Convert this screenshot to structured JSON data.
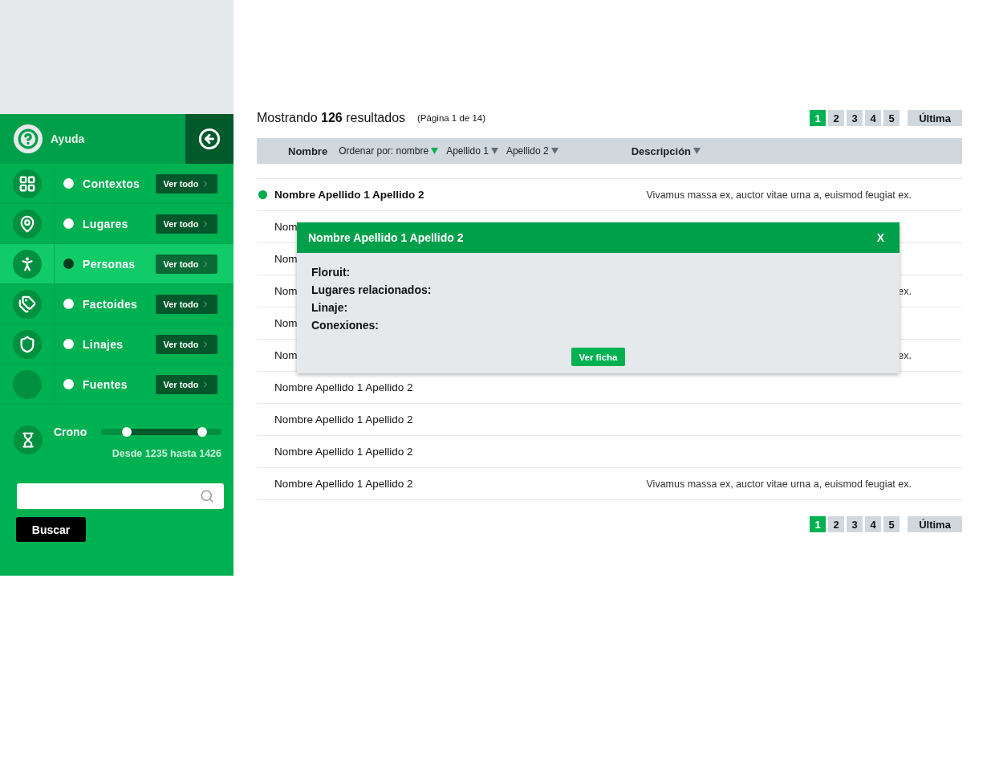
{
  "sidebar": {
    "help": {
      "label": "Ayuda"
    },
    "items": [
      {
        "label": "Contextos",
        "selected": false,
        "button": "Ver todo"
      },
      {
        "label": "Lugares",
        "selected": false,
        "button": "Ver todo"
      },
      {
        "label": "Personas",
        "selected": true,
        "button": "Ver todo"
      },
      {
        "label": "Factoides",
        "selected": false,
        "button": "Ver todo"
      },
      {
        "label": "Linajes",
        "selected": false,
        "button": "Ver todo"
      },
      {
        "label": "Fuentes",
        "selected": false,
        "button": "Ver todo"
      }
    ],
    "crono": {
      "label": "Crono",
      "thumbs": [
        {
          "level": 0.21
        },
        {
          "level": 0.84
        }
      ],
      "range_text": "Desde 1235 hasta 1426"
    },
    "search": {
      "button": "Buscar"
    }
  },
  "results": {
    "prefix": "Mostrando",
    "count": "126",
    "suffix": "resultados",
    "page_info": "(Página 1 de 14)"
  },
  "pagination_top": {
    "pages": [
      {
        "label": "1",
        "selected": true
      },
      {
        "label": "2",
        "selected": false
      },
      {
        "label": "3",
        "selected": false
      },
      {
        "label": "4",
        "selected": false
      },
      {
        "label": "5",
        "selected": false
      }
    ],
    "last": "Última"
  },
  "table": {
    "name_heading": "Nombre",
    "sort_options": [
      {
        "label": "Ordenar por: nombre",
        "selected": true
      },
      {
        "label": "Apellido 1",
        "selected": false
      },
      {
        "label": "Apellido 2",
        "selected": false
      }
    ],
    "description_heading": "Descripción",
    "rows": [
      {
        "name": "Nombre Apellido 1 Apellido 2",
        "description": "Vivamus massa ex, auctor vitae urna a, euismod feugiat ex.",
        "selected": true
      },
      {
        "name": "Nom",
        "selected": false
      },
      {
        "name": "Nom",
        "selected": false
      },
      {
        "name": "Nom",
        "description": "ex.",
        "selected": false
      },
      {
        "name": "Nom",
        "selected": false
      },
      {
        "name": "Nom",
        "description": "ex.",
        "selected": false
      },
      {
        "name": "Nombre Apellido 1 Apellido 2",
        "selected": false
      },
      {
        "name": "Nombre Apellido 1 Apellido 2",
        "selected": false
      },
      {
        "name": "Nombre Apellido 1 Apellido 2",
        "selected": false
      },
      {
        "name": "Nombre Apellido 1 Apellido 2",
        "description": "Vivamus massa ex, auctor vitae urna a, euismod feugiat ex.",
        "selected": false
      }
    ]
  },
  "popup": {
    "title": "Nombre Apellido 1 Apellido 2",
    "close": "X",
    "fields": [
      "Floruit:",
      "Lugares relacionados:",
      "Linaje:",
      "Conexiones:"
    ],
    "button": "Ver ficha"
  },
  "pagination_bottom": {
    "pages": [
      {
        "label": "1",
        "selected": true
      },
      {
        "label": "2",
        "selected": false
      },
      {
        "label": "3",
        "selected": false
      },
      {
        "label": "4",
        "selected": false
      },
      {
        "label": "5",
        "selected": false
      }
    ],
    "last": "Última"
  }
}
